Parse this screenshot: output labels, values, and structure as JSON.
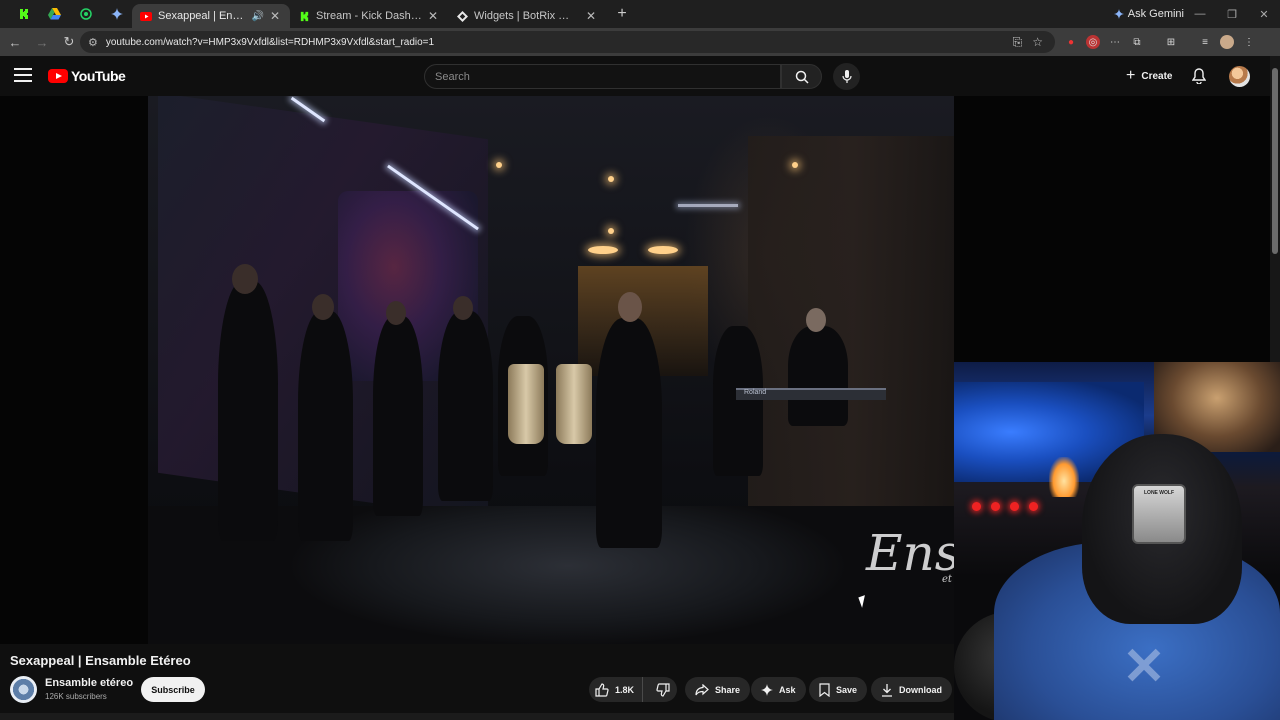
{
  "browser": {
    "tabs": [
      {
        "title": "Sexappeal | Ensamble Etére",
        "active": true,
        "favicon": "youtube-icon",
        "audio": true
      },
      {
        "title": "Stream - Kick Dashboard",
        "active": false,
        "favicon": "kick-icon"
      },
      {
        "title": "Widgets | BotRix — Cloud Strea",
        "active": false,
        "favicon": "botrix-icon"
      }
    ],
    "gemini_label": "Ask Gemini",
    "url": "youtube.com/watch?v=HMP3x9Vxfdl&list=RDHMP3x9Vxfdl&start_radio=1"
  },
  "youtube": {
    "logo_text": "YouTube",
    "search_placeholder": "Search",
    "create_label": "Create"
  },
  "video": {
    "watermark": "Ens",
    "watermark_sub": "et",
    "keyboard_brand": "Roland",
    "patch_text": "LONE WOLF"
  },
  "details": {
    "title": "Sexappeal | Ensamble Etéreo",
    "channel_name": "Ensamble etéreo",
    "subscribers": "126K subscribers",
    "subscribe_label": "Subscribe",
    "likes": "1.8K",
    "share_label": "Share",
    "ask_label": "Ask",
    "save_label": "Save",
    "download_label": "Download"
  },
  "colors": {
    "youtube_red": "#ff0000",
    "background": "#0f0f0f",
    "pill": "#272727",
    "kick_green": "#53fc18"
  }
}
